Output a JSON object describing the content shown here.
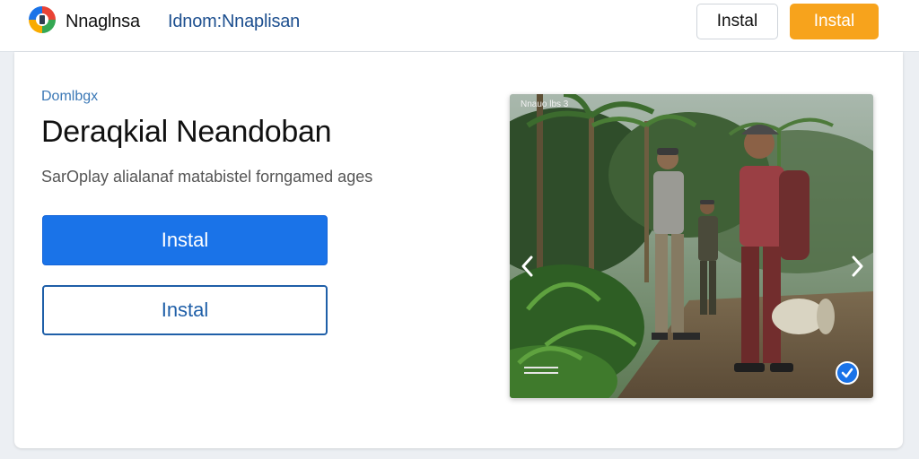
{
  "header": {
    "brand": "Nnaglnsa",
    "nav_link": "Idnom:Nnaplisan",
    "install_outline_label": "Instal",
    "install_orange_label": "Instal"
  },
  "hero": {
    "kicker": "Domlbgx",
    "title": "Deraqkial Neandoban",
    "subtitle": "SarOplay alialanaf matabistel forngamed ages",
    "primary_button_label": "Instal",
    "secondary_button_label": "Instal"
  },
  "carousel": {
    "caption": "Nnauo lbs 3",
    "prev_icon": "chevron-left-icon",
    "next_icon": "chevron-right-icon",
    "badge_icon": "check-badge-icon"
  },
  "colors": {
    "accent_blue": "#1a73e8",
    "accent_orange": "#f7a31c",
    "link_blue": "#1d4f8f"
  }
}
